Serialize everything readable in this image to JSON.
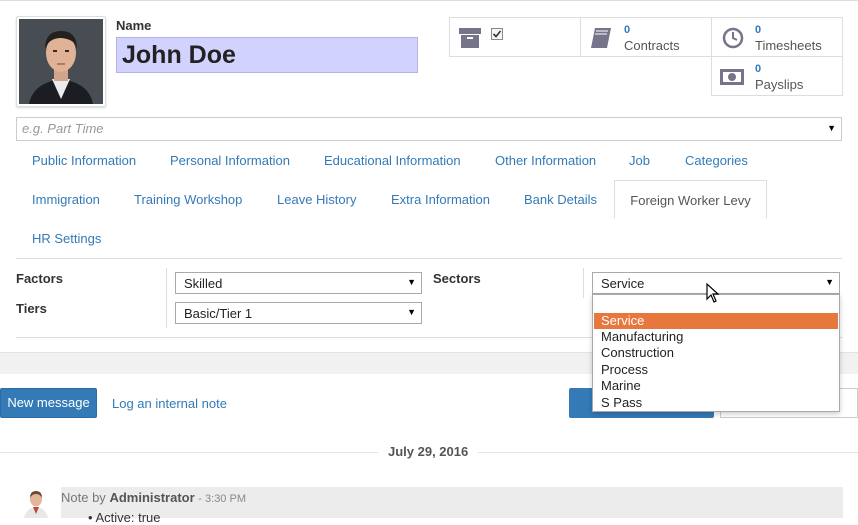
{
  "header": {
    "name_label": "Name",
    "name_value": "John Doe",
    "job_placeholder": "e.g. Part Time"
  },
  "smart_buttons": [
    {
      "icon": "archive-icon",
      "count": "",
      "label": ""
    },
    {
      "icon": "book-icon",
      "count": "0",
      "label": "Contracts"
    },
    {
      "icon": "clock-icon",
      "count": "0",
      "label": "Timesheets"
    },
    {
      "icon": "money-icon",
      "count": "0",
      "label": "Payslips"
    }
  ],
  "tabs": {
    "row1": [
      "Public Information",
      "Personal Information",
      "Educational Information",
      "Other Information",
      "Job",
      "Categories"
    ],
    "row2": [
      "Immigration",
      "Training Workshop",
      "Leave History",
      "Extra Information",
      "Bank Details",
      "Foreign Worker Levy"
    ],
    "row3": [
      "HR Settings"
    ],
    "active": "Foreign Worker Levy"
  },
  "form": {
    "factors_label": "Factors",
    "factors_value": "Skilled",
    "tiers_label": "Tiers",
    "tiers_value": "Basic/Tier 1",
    "sectors_label": "Sectors",
    "sectors_value": "Service"
  },
  "sectors_dropdown": {
    "options": [
      "",
      "Service",
      "Manufacturing",
      "Construction",
      "Process",
      "Marine",
      "S Pass"
    ],
    "highlighted": "Service"
  },
  "chatter": {
    "new_message": "New message",
    "log_note": "Log an internal note",
    "date": "July 29, 2016",
    "note_prefix": "Note by",
    "note_author": "Administrator",
    "note_time": "- 3:30 PM",
    "note_line": "Active: true"
  },
  "colors": {
    "link": "#337ab7",
    "name_bg": "#d2d2ff",
    "highlight": "#e8773d"
  }
}
